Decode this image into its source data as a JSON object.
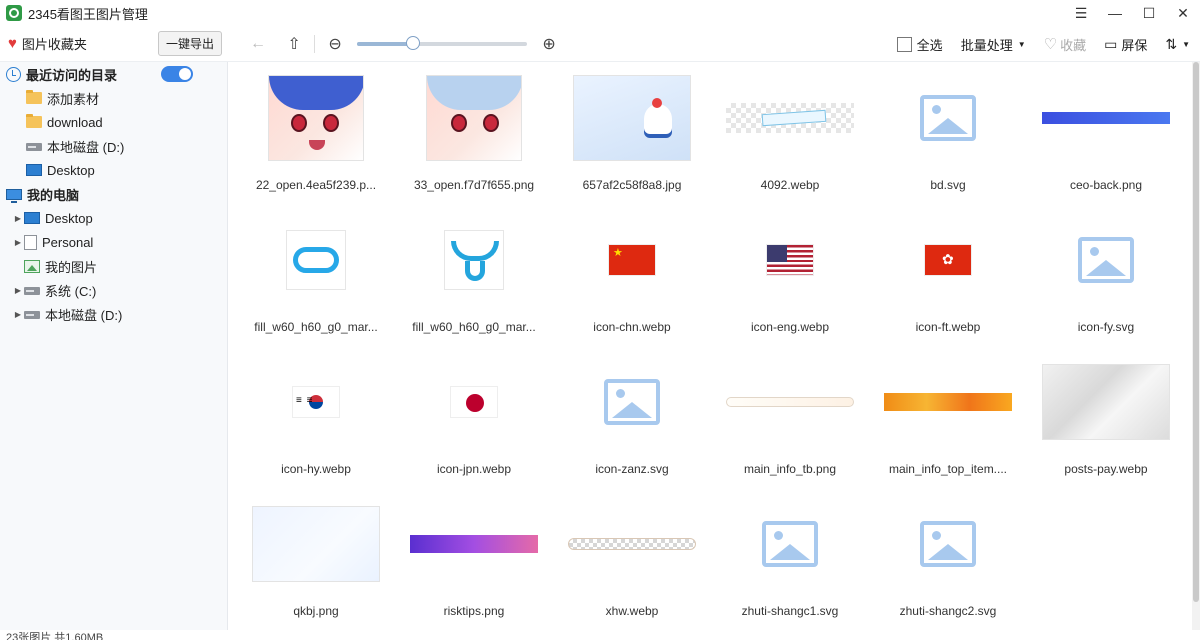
{
  "window": {
    "title": "2345看图王图片管理"
  },
  "toolbar": {
    "favorites_label": "图片收藏夹",
    "export_label": "一键导出",
    "select_all_label": "全选",
    "batch_label": "批量处理",
    "favorite_label": "收藏",
    "screen_label": "屏保",
    "zoom_level": 0.33
  },
  "sidebar": {
    "recent_label": "最近访问的目录",
    "recent_items": [
      "添加素材",
      "download",
      "本地磁盘 (D:)",
      "Desktop"
    ],
    "my_computer_label": "我的电脑",
    "computer_items": [
      "Desktop",
      "Personal",
      "我的图片",
      "系统 (C:)",
      "本地磁盘 (D:)"
    ]
  },
  "files": [
    {
      "name": "22_open.4ea5f239.p..."
    },
    {
      "name": "33_open.f7d7f655.png"
    },
    {
      "name": "657af2c58f8a8.jpg"
    },
    {
      "name": "4092.webp"
    },
    {
      "name": "bd.svg"
    },
    {
      "name": "ceo-back.png"
    },
    {
      "name": "fill_w60_h60_g0_mar..."
    },
    {
      "name": "fill_w60_h60_g0_mar..."
    },
    {
      "name": "icon-chn.webp"
    },
    {
      "name": "icon-eng.webp"
    },
    {
      "name": "icon-ft.webp"
    },
    {
      "name": "icon-fy.svg"
    },
    {
      "name": "icon-hy.webp"
    },
    {
      "name": "icon-jpn.webp"
    },
    {
      "name": "icon-zanz.svg"
    },
    {
      "name": "main_info_tb.png"
    },
    {
      "name": "main_info_top_item...."
    },
    {
      "name": "posts-pay.webp"
    },
    {
      "name": "qkbj.png"
    },
    {
      "name": "risktips.png"
    },
    {
      "name": "xhw.webp"
    },
    {
      "name": "zhuti-shangc1.svg"
    },
    {
      "name": "zhuti-shangc2.svg"
    }
  ],
  "status": {
    "text": "23张图片 共1.60MB"
  }
}
